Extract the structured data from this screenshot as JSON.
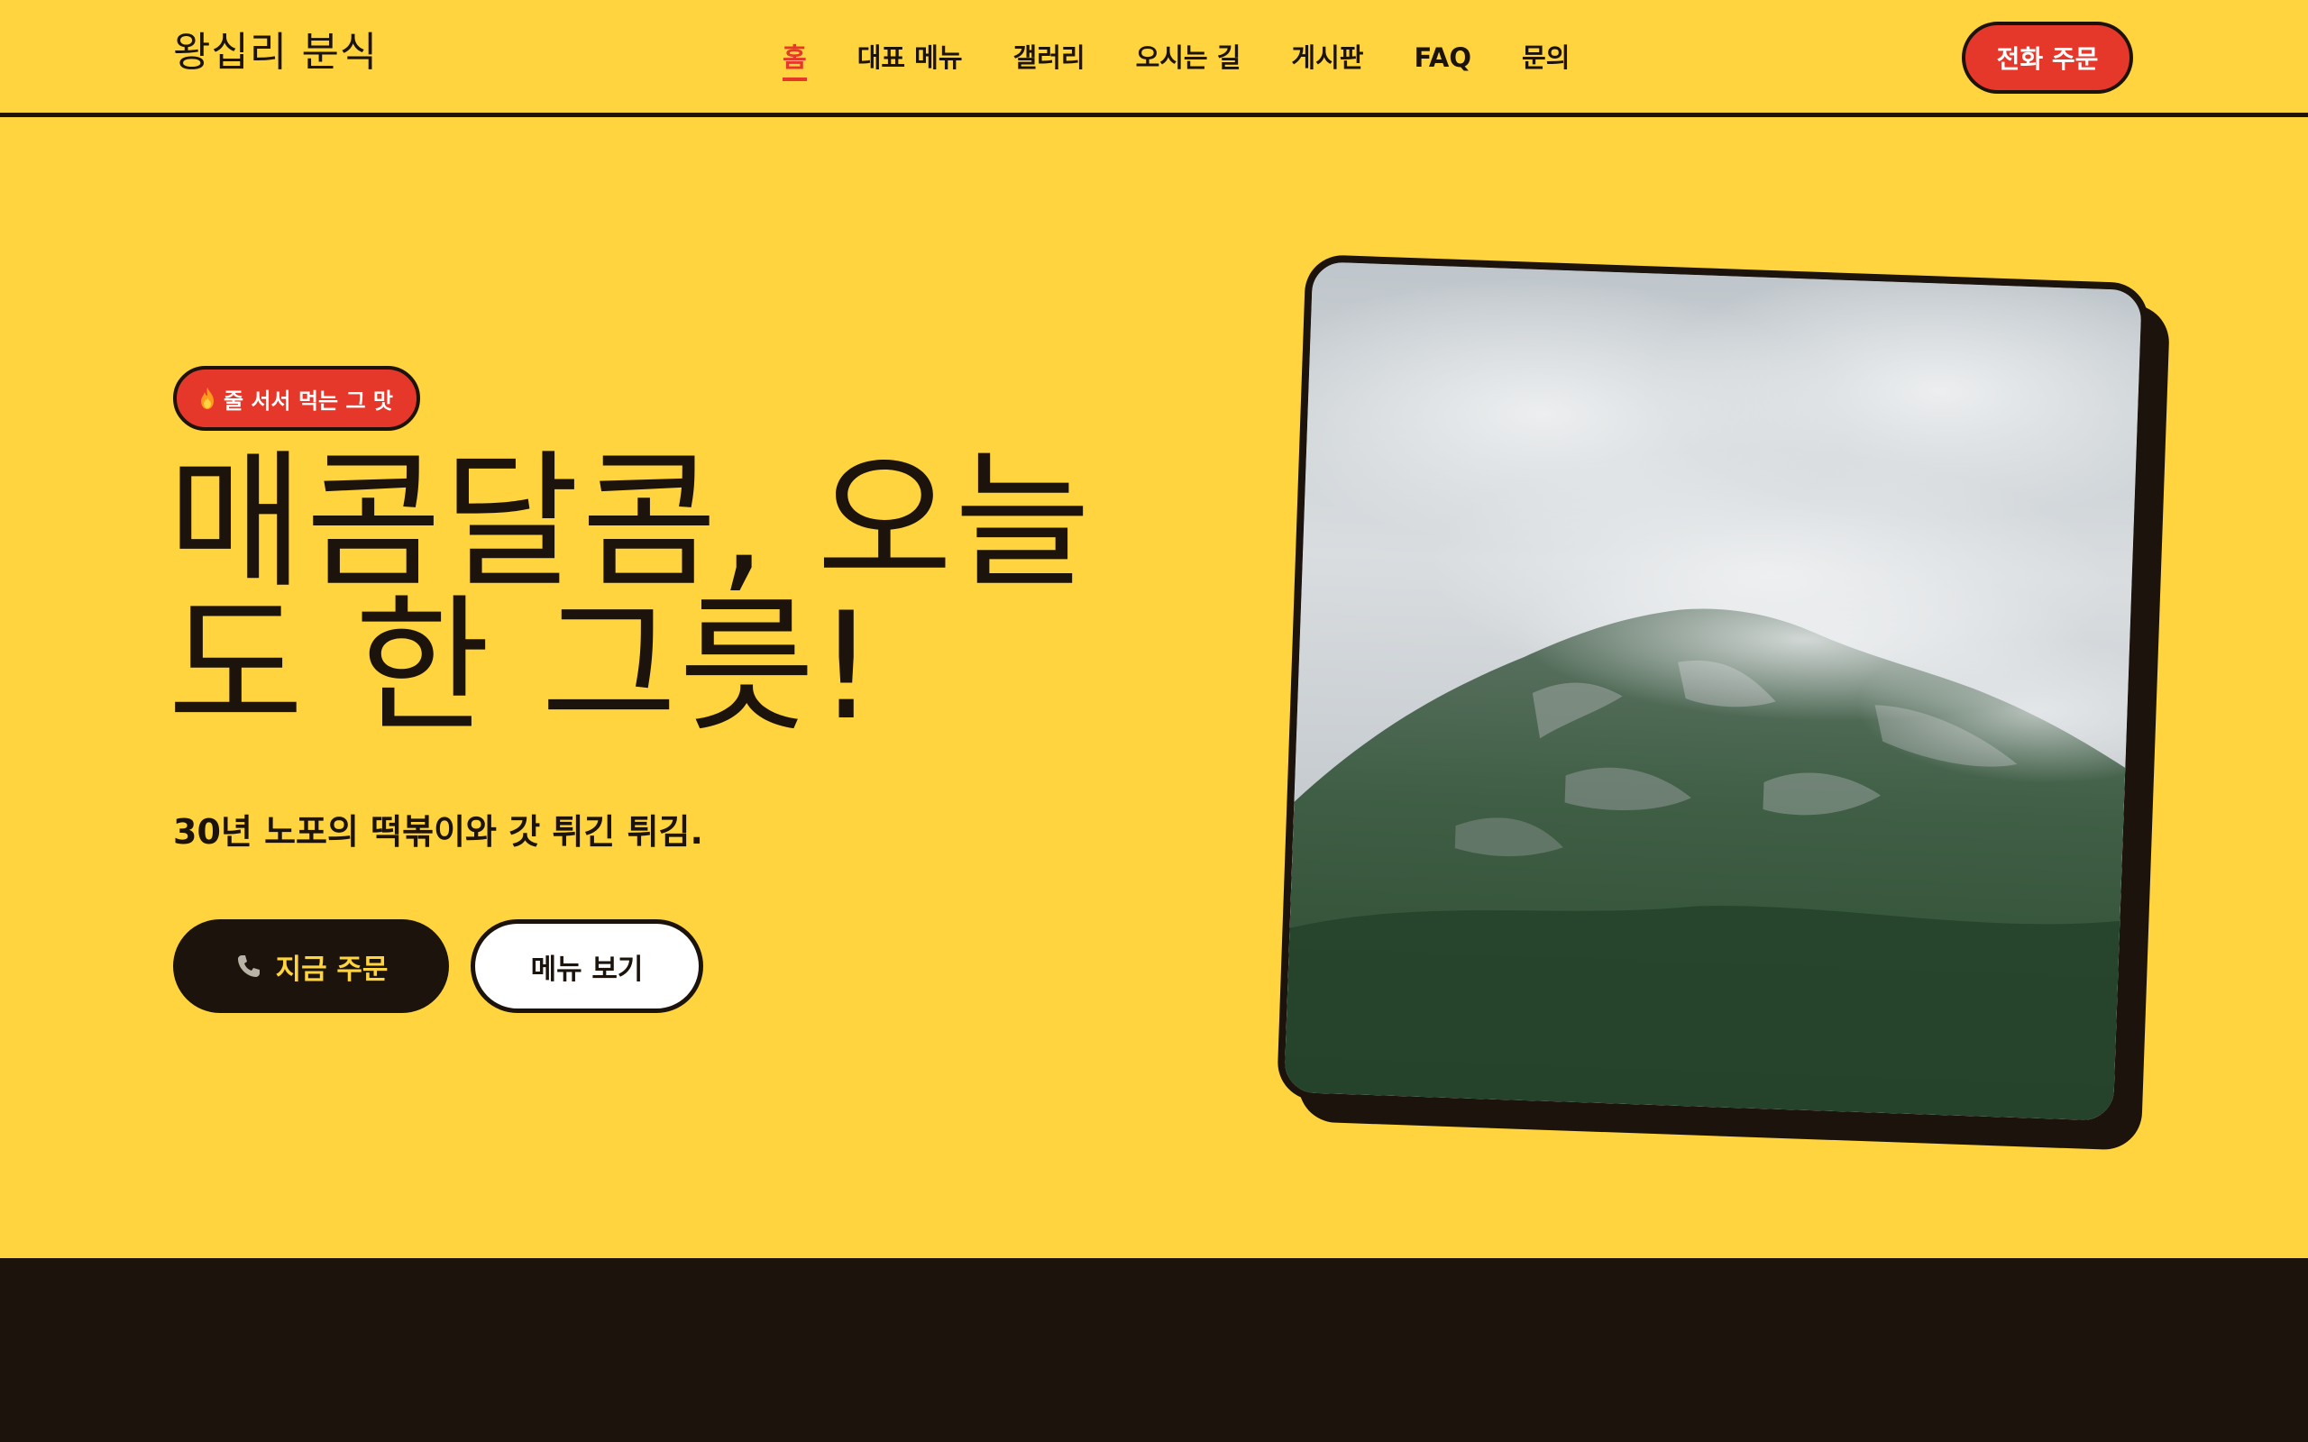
{
  "brand": {
    "name": "왕십리 분식"
  },
  "nav": {
    "items": [
      {
        "label": "홈",
        "active": true
      },
      {
        "label": "대표 메뉴",
        "active": false
      },
      {
        "label": "갤러리",
        "active": false
      },
      {
        "label": "오시는 길",
        "active": false
      },
      {
        "label": "게시판",
        "active": false
      },
      {
        "label": "FAQ",
        "active": false
      },
      {
        "label": "문의",
        "active": false
      }
    ],
    "cta_label": "전화 주문"
  },
  "hero": {
    "badge_icon": "fire-icon",
    "badge_text": "줄 서서 먹는 그 맛",
    "headline": "매콤달콤, 오늘도 한 그릇!",
    "subtext": "30년 노포의 떡볶이와 갓 튀긴 튀김.",
    "primary_button_icon": "phone-icon",
    "primary_button_label": "지금 주문",
    "secondary_button_label": "메뉴 보기",
    "image_subject": "mist-covered forested mountain"
  },
  "colors": {
    "background": "#FFD43E",
    "accent": "#E5382B",
    "ink": "#1C140C",
    "white": "#FFFFFF"
  }
}
